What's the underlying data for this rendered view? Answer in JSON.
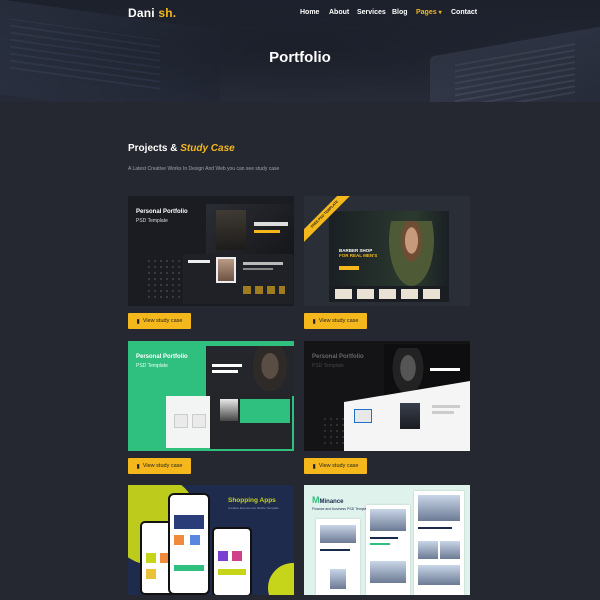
{
  "brand": {
    "name": "Dani",
    "accent": "sh.",
    "accent_color": "#f4b81c"
  },
  "nav": {
    "items": [
      {
        "label": "Home"
      },
      {
        "label": "About"
      },
      {
        "label": "Services"
      },
      {
        "label": "Blog"
      },
      {
        "label": "Pages",
        "active": true,
        "caret": "▾"
      },
      {
        "label": "Contact"
      }
    ]
  },
  "hero": {
    "title": "Portfolio"
  },
  "section": {
    "title_plain": "Projects &",
    "title_accent": "Study Case",
    "subtitle": "A Latest Creative Works In Design And Web you can see study case"
  },
  "cards": [
    {
      "title": "Personal Portfolio",
      "subtitle": "PSD Template",
      "button": "View study case",
      "button_icon": "bookmark-icon"
    },
    {
      "headline": "BARBER SHOP",
      "headline2": "FOR REAL MEN'S",
      "ribbon": "FREE PSD TEMPLATE",
      "button": "View study case",
      "button_icon": "bookmark-icon"
    },
    {
      "title": "Personal Portfolio",
      "subtitle": "PSD Template",
      "button": "View study case",
      "button_icon": "bookmark-icon"
    },
    {
      "title": "Personal Portfolio",
      "subtitle": "PSD Template",
      "button": "View study case",
      "button_icon": "bookmark-icon"
    },
    {
      "title": "Shopping Apps",
      "subtitle": "Creative Ecommerce Mobile Template"
    },
    {
      "brand_mark": "M",
      "brand": "Minance",
      "subtitle": "Finance and business PSD Template"
    }
  ],
  "colors": {
    "background": "#252830",
    "accent": "#f4b81c",
    "green": "#2fbf7e",
    "lime": "#c6d41a"
  }
}
